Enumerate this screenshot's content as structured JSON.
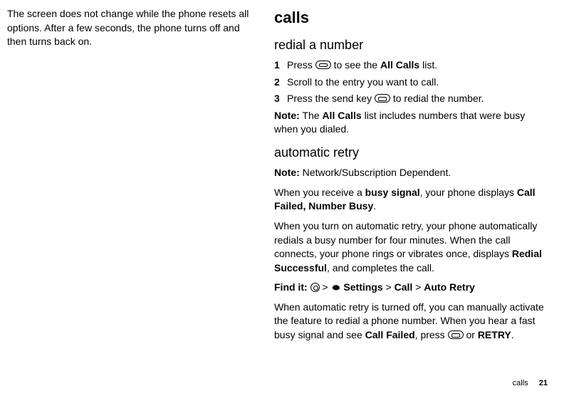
{
  "left": {
    "para": "The screen does not change while the phone resets all options. After a few seconds, the phone turns off and then turns back on."
  },
  "right": {
    "h1": "calls",
    "redial": {
      "h2": "redial a number",
      "steps": [
        {
          "num": "1",
          "pre": "Press ",
          "post": " to see the ",
          "bold": "All Calls",
          "tail": " list."
        },
        {
          "num": "2",
          "text": "Scroll to the entry you want to call."
        },
        {
          "num": "3",
          "pre": "Press the send key ",
          "post": " to redial the number."
        }
      ],
      "note_label": "Note:",
      "note_pre": " The ",
      "note_bold": "All Calls",
      "note_post": " list includes numbers that were busy when you dialed."
    },
    "auto": {
      "h2": "automatic retry",
      "note_label": "Note:",
      "note_text": " Network/Subscription Dependent.",
      "p1_pre": " When you receive a ",
      "p1_b1": "busy signal",
      "p1_mid": ", your phone displays ",
      "p1_b2": "Call Failed, Number Busy",
      "p1_tail": ".",
      "p2_pre": "When you turn on automatic retry, your phone automatically redials a busy number for four minutes. When the call connects, your phone rings or vibrates once, displays ",
      "p2_b": "Redial Successful",
      "p2_tail": ", and completes the call.",
      "find_label": "Find it: ",
      "find_sep1": " > ",
      "find_b1": "Settings",
      "find_sep2": " > ",
      "find_b2": "Call",
      "find_sep3": " > ",
      "find_b3": "Auto Retry",
      "p3_pre": "When automatic retry is turned off, you can manually activate the feature to redial a phone number. When you hear a fast busy signal and see ",
      "p3_b1": "Call Failed",
      "p3_mid": ", press ",
      "p3_or": " or ",
      "p3_b2": "RETRY",
      "p3_tail": "."
    }
  },
  "footer": {
    "section": "calls",
    "page": "21"
  }
}
